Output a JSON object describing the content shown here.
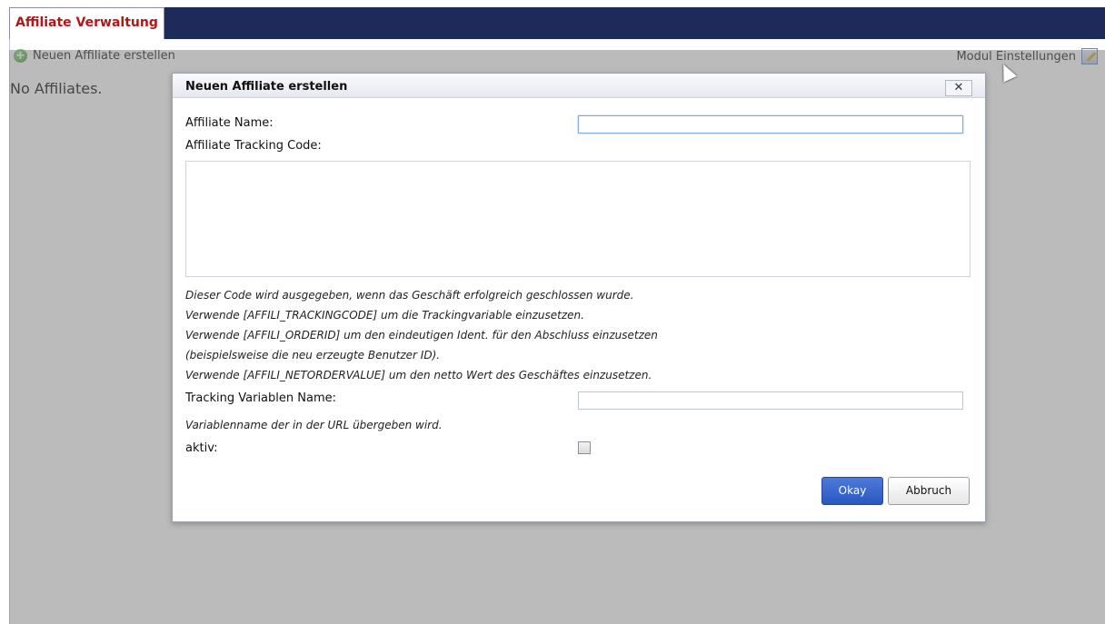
{
  "header": {
    "tab_label": "Affiliate Verwaltung"
  },
  "toolbar": {
    "new_affiliate_label": "Neuen Affiliate erstellen",
    "settings_label": "Modul Einstellungen"
  },
  "main": {
    "empty_text": "No Affiliates."
  },
  "dialog": {
    "title": "Neuen Affiliate erstellen",
    "close_label": "✕",
    "name_label": "Affiliate Name:",
    "name_value": "",
    "tracking_code_label": "Affiliate Tracking Code:",
    "tracking_code_value": "",
    "notes": [
      "Dieser Code wird ausgegeben, wenn das Geschäft erfolgreich geschlossen wurde.",
      "Verwende [AFFILI_TRACKINGCODE] um die Trackingvariable einzusetzen.",
      "Verwende [AFFILI_ORDERID] um den eindeutigen Ident. für den Abschluss einzusetzen",
      "(beispielsweise die neu erzeugte Benutzer ID).",
      "Verwende [AFFILI_NETORDERVALUE] um den netto Wert des Geschäftes einzusetzen."
    ],
    "tracking_var_label": "Tracking Variablen Name:",
    "tracking_var_value": "",
    "tracking_var_note": "Variablenname der in der URL übergeben wird.",
    "active_label": "aktiv:",
    "active_checked": false,
    "ok_label": "Okay",
    "cancel_label": "Abbruch"
  },
  "colors": {
    "header_bg": "#1e2a5a",
    "tab_text": "#b01818",
    "ok_button": "#2a58c2",
    "overlay": "#787878"
  },
  "icons": {
    "new": "plus-circle-icon",
    "settings": "edit-icon",
    "close": "close-icon"
  }
}
